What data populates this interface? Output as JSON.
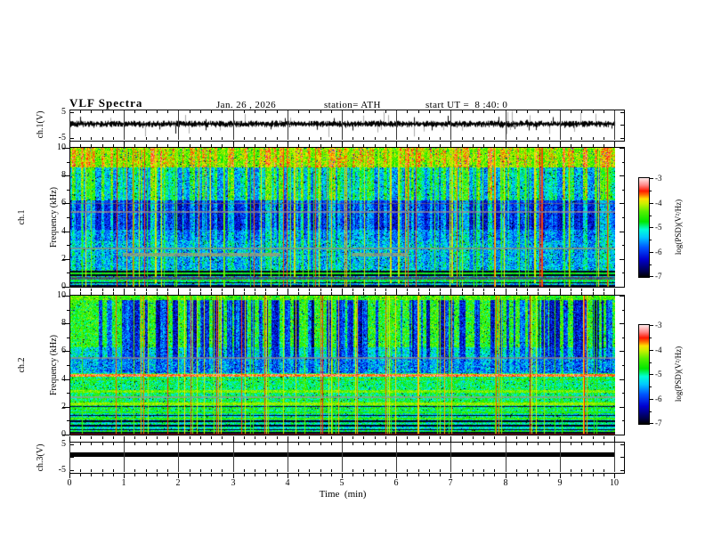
{
  "title": "VLF Spectra",
  "header": {
    "date": "Jan. 26 , 2026",
    "station": "station= ATH",
    "start_ut": "start UT =  8 :40: 0"
  },
  "x_axis": {
    "label": "Time  (min)",
    "range": [
      0,
      10
    ],
    "ticks": [
      "0",
      "1",
      "2",
      "3",
      "4",
      "5",
      "6",
      "7",
      "8",
      "9",
      "10"
    ],
    "minor_divisions": 5
  },
  "colorbar": {
    "label": "log(PSD)(V²/Hz)",
    "range": [
      -7,
      -3
    ],
    "ticks": [
      "-3",
      "-4",
      "-5",
      "-6",
      "-7"
    ]
  },
  "colormap": {
    "stops": [
      [
        0.0,
        "#000000"
      ],
      [
        0.06,
        "#000050"
      ],
      [
        0.18,
        "#0000d0"
      ],
      [
        0.3,
        "#0055ff"
      ],
      [
        0.4,
        "#00c8ff"
      ],
      [
        0.48,
        "#00ffd8"
      ],
      [
        0.56,
        "#00e800"
      ],
      [
        0.66,
        "#55f000"
      ],
      [
        0.74,
        "#c8f000"
      ],
      [
        0.79,
        "#ffe000"
      ],
      [
        0.83,
        "#ff7000"
      ],
      [
        0.87,
        "#ff1800"
      ],
      [
        0.93,
        "#ff8888"
      ],
      [
        1.0,
        "#ffecec"
      ]
    ]
  },
  "chart_data": [
    {
      "type": "line",
      "id": "ch1_waveform",
      "ylabel": "ch.1(V)",
      "ylim": [
        -5,
        5
      ],
      "yticks": [
        "5",
        "-5"
      ],
      "description": "Broadband noisy voltage trace centered near 0 V with frequent impulsive sferic spikes reaching about ±5 V over the full 10 min record.",
      "render": {
        "seed": 11,
        "center": 0.6,
        "noise": 1.0,
        "spike_rate": 0.05,
        "gray_spike_rate": 0.035
      }
    },
    {
      "type": "heatmap",
      "id": "ch1_spectrogram",
      "ylabel_line1": "ch.1",
      "ylabel_line2": "Frequency (kHz)",
      "ylim": [
        0,
        10
      ],
      "yticks": [
        "10",
        "8",
        "6",
        "4",
        "2",
        "0"
      ],
      "zlabel": "log(PSD)(V²/Hz)",
      "zlim": [
        -7,
        -3
      ],
      "description": "Spectrogram 0-10 kHz: bright green/yellow band with red flecks above ~8.6 kHz, green vertical sferic streaks over blue 6-8.6 kHz, dark blue 4-6 kHz, cyan speckle 1-4 kHz, and dark banded stripes below 1.2 kHz; gray interference lines near 5.4 and 6 kHz, olive patches near 2.3 kHz.",
      "bands": [
        {
          "f": [
            8.6,
            10
          ],
          "base": -4.3,
          "noise": 0.5,
          "streak": 0.8
        },
        {
          "f": [
            6.2,
            8.6
          ],
          "base": -5.45,
          "noise": 0.5,
          "streak": 1.5
        },
        {
          "f": [
            4.1,
            6.2
          ],
          "base": -6.15,
          "noise": 0.45,
          "streak": 1.15
        },
        {
          "f": [
            3.35,
            4.1
          ],
          "base": -5.75,
          "noise": 0.5,
          "streak": 0.85
        },
        {
          "f": [
            1.2,
            3.35
          ],
          "base": -5.55,
          "noise": 0.55,
          "streak": 0.65
        },
        {
          "f": [
            0,
            1.2
          ],
          "base": -5.2,
          "noise": 0.7,
          "streak": 0.3
        }
      ],
      "hlines": [
        {
          "f": 6.0,
          "hw": 0.04,
          "color": "#7a6f74",
          "mottle": 0.6
        },
        {
          "f": 5.4,
          "hw": 0.07,
          "color": "#9b8f94",
          "mottle": 0.5
        },
        {
          "f": 2.75,
          "hw": 0.04,
          "color": "#8f9a78",
          "mottle": 0.5
        },
        {
          "f": 2.3,
          "hw": 0.12,
          "color": "#a8a06a",
          "mottle": 0.55,
          "trange": [
            0.95,
            3.85
          ]
        },
        {
          "f": 2.3,
          "hw": 0.12,
          "color": "#a8a06a",
          "mottle": 0.55,
          "trange": [
            5.15,
            6.2
          ]
        },
        {
          "f": 1.1,
          "hw": 0.06,
          "v": -6.9,
          "jit": 0.1
        },
        {
          "f": 0.95,
          "hw": 0.05,
          "v": -4.7,
          "jit": 0.3
        },
        {
          "f": 0.82,
          "hw": 0.06,
          "v": -6.9,
          "jit": 0.1
        },
        {
          "f": 0.6,
          "hw": 0.09,
          "color": "#5a2a66",
          "mottle": 0.65
        },
        {
          "f": 0.44,
          "hw": 0.05,
          "v": -4.8,
          "jit": 0.3
        },
        {
          "f": 0.3,
          "hw": 0.05,
          "v": -6.9,
          "jit": 0.15
        },
        {
          "f": 0.17,
          "hw": 0.05,
          "v": -5.5,
          "jit": 0.5
        },
        {
          "f": 0.05,
          "hw": 0.05,
          "v": -6.9,
          "jit": 0.1
        }
      ],
      "vlines_red_t": [
        1.55,
        4.1,
        5.87,
        6.02,
        7.0,
        8.52
      ],
      "render": {
        "seed": 21,
        "green_line_prob": 0.11,
        "dark_runs": false,
        "speck_prob": 0.03
      }
    },
    {
      "type": "heatmap",
      "id": "ch2_spectrogram",
      "ylabel_line1": "ch.2",
      "ylabel_line2": "Frequency (kHz)",
      "ylim": [
        0,
        10
      ],
      "yticks": [
        "10",
        "8",
        "6",
        "4",
        "2",
        "0"
      ],
      "zlabel": "log(PSD)(V²/Hz)",
      "zlim": [
        -7,
        -3
      ],
      "description": "Spectrogram 0-10 kHz: cyan/green background with wide dark-blue vertical dropouts 6-10 kHz, blue speckle 4.5-5.5 kHz, red interference line near 4.3 kHz, yellow bands near 3.1 and 2.2 kHz, dense horizontal striping below 2 kHz and a dark red line at 0 kHz.",
      "bands": [
        {
          "f": [
            9.7,
            10
          ],
          "base": -4.4,
          "noise": 0.4,
          "streak": -0.3
        },
        {
          "f": [
            6.3,
            9.7
          ],
          "base": -4.85,
          "noise": 0.5,
          "streak": -1.9
        },
        {
          "f": [
            5.5,
            6.3
          ],
          "base": -5.3,
          "noise": 0.5,
          "streak": -1.1
        },
        {
          "f": [
            4.45,
            5.5
          ],
          "base": -5.5,
          "noise": 0.6,
          "streak": -0.5
        },
        {
          "f": [
            2.45,
            4.45
          ],
          "base": -4.85,
          "noise": 0.5,
          "streak": -0.18
        },
        {
          "f": [
            1.75,
            2.45
          ],
          "base": -4.75,
          "noise": 0.45,
          "streak": -0.08
        },
        {
          "f": [
            0,
            1.75
          ],
          "base": -5.1,
          "noise": 0.6,
          "streak": 0
        }
      ],
      "hlines": [
        {
          "f": 5.5,
          "hw": 0.05,
          "color": "#8a8a8a",
          "mottle": 0.5
        },
        {
          "f": 4.27,
          "hw": 0.09,
          "v": -3.5,
          "jit": 0.45
        },
        {
          "f": 3.95,
          "hw": 0.05,
          "v": -4.5,
          "jit": 0.3
        },
        {
          "f": 3.1,
          "hw": 0.08,
          "v": -4.3,
          "jit": 0.3
        },
        {
          "f": 2.7,
          "hw": 0.04,
          "color": "#9a9a86",
          "mottle": 0.5
        },
        {
          "f": 2.2,
          "hw": 0.09,
          "v": -4.2,
          "jit": 0.25
        },
        {
          "f": 2.02,
          "hw": 0.04,
          "v": -6.7,
          "jit": 0.3
        },
        {
          "f": 1.6,
          "hw": 0.04,
          "v": -4.6,
          "jit": 0.3
        },
        {
          "f": 1.38,
          "hw": 0.05,
          "v": -6.8,
          "jit": 0.2
        },
        {
          "f": 1.15,
          "hw": 0.06,
          "v": -4.5,
          "jit": 0.3
        },
        {
          "f": 0.95,
          "hw": 0.06,
          "v": -6.9,
          "jit": 0.15
        },
        {
          "f": 0.78,
          "hw": 0.04,
          "v": -5.0,
          "jit": 0.4
        },
        {
          "f": 0.62,
          "hw": 0.06,
          "v": -6.9,
          "jit": 0.15
        },
        {
          "f": 0.5,
          "hw": 0.04,
          "v": -5.2,
          "jit": 0.4
        },
        {
          "f": 0.36,
          "hw": 0.05,
          "v": -6.9,
          "jit": 0.15
        },
        {
          "f": 0.24,
          "hw": 0.04,
          "v": -4.7,
          "jit": 0.3
        },
        {
          "f": 0.12,
          "hw": 0.06,
          "v": -6.9,
          "jit": 0.1
        },
        {
          "f": 0.03,
          "hw": 0.04,
          "color": "#990000",
          "mottle": 0.2
        }
      ],
      "vlines_red_t": [],
      "render": {
        "seed": 33,
        "green_line_prob": 0.1,
        "dark_runs": true,
        "speck_prob": 0.025
      }
    },
    {
      "type": "line",
      "id": "ch3_waveform",
      "ylabel": "ch.3(V)",
      "ylim": [
        -5,
        5
      ],
      "yticks": [
        "5",
        "-5"
      ],
      "description": "Flat channel: constant thick black trace at about +1 V for the entire 10 minutes.",
      "render": {
        "value": 1.0,
        "thickness": 5
      }
    }
  ]
}
